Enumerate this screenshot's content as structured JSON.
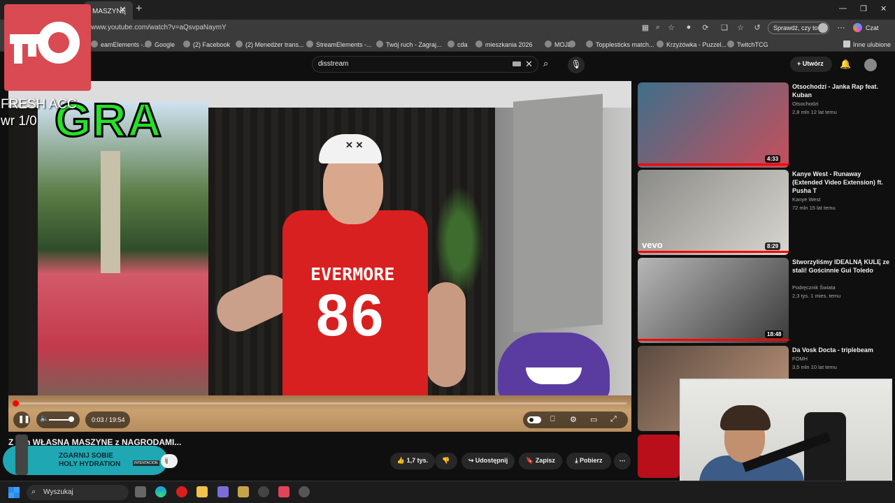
{
  "browser": {
    "tab_title": "MASZYNĘ",
    "url": "www.youtube.com/watch?v=aQsvpaNaymY",
    "profile_button": "Sprawdź, czy to Ty",
    "copilot_label": "Czat",
    "bookmarks": [
      "eamElements -...",
      "Google",
      "(2) Facebook",
      "(2) Menedżer trans...",
      "StreamElements -...",
      "Twój ruch - Zagraj...",
      "cda",
      "mieszkania 2026",
      "MOJE",
      "",
      "Topplesticks match...",
      "Krzyżówka - Puzzel...",
      "TwitchTCG"
    ],
    "other_favorites": "Inne ulubione"
  },
  "youtube": {
    "search_value": "disstream",
    "create_label": "Utwórz"
  },
  "video": {
    "overlay_text": "GRA",
    "shirt_brand": "EVERMORE",
    "shirt_number": "86",
    "time": "0:03 / 19:54",
    "progress_fraction": 0.0026,
    "title": "Zbudowałem WŁASNĄ MASZYNĘ z NAGRODAMI...",
    "title_visible": "Z  łem WŁASNĄ MASZYNE z NAGRODAMI...",
    "likes": "1,7 tys.",
    "share": "Udostępnij",
    "save": "Zapisz",
    "download": "Pobierz"
  },
  "stream_overlay": {
    "line1": "FRESH ACC",
    "line2": "wr 1/0",
    "banner_line1": "ZGARNIJ SOBIE",
    "banner_line2": "HOLY HYDRATION",
    "banner_tag": "INTENTACION",
    "subscribe_stub": "ij"
  },
  "recommendations": [
    {
      "title": "Otsochodzi - Janka Rap feat. Kuban",
      "channel": "Otsochodzi",
      "meta": "2,8 mln  12 lat temu",
      "duration": "4:33",
      "colors": [
        "#3f6f8a",
        "#c64f5c"
      ]
    },
    {
      "title": "Kanye West - Runaway (Extended Video Extension) ft. Pusha T",
      "channel": "Kanye West",
      "meta": "72 mln  15 lat temu",
      "duration": "8:29",
      "colors": [
        "#8a8a86",
        "#d8d6d0"
      ],
      "badge": "vevo"
    },
    {
      "title": "Stworzyliśmy IDEALNĄ KULĘ ze stali! Gościnnie Gui Toledo",
      "channel": "Podręcznik Świata",
      "meta": "2,3 tys.  1 mies. temu",
      "duration": "18:48",
      "colors": [
        "#b7b7b7",
        "#3a3a3a"
      ]
    },
    {
      "title": "Da Vosk Docta - triplebeam",
      "channel": "FOMH",
      "meta": "3,5 mln  10 lat temu",
      "duration": "",
      "colors": [
        "#5a4a40",
        "#c49a7e"
      ]
    }
  ],
  "taskbar": {
    "search_placeholder": "Wyszukaj"
  }
}
